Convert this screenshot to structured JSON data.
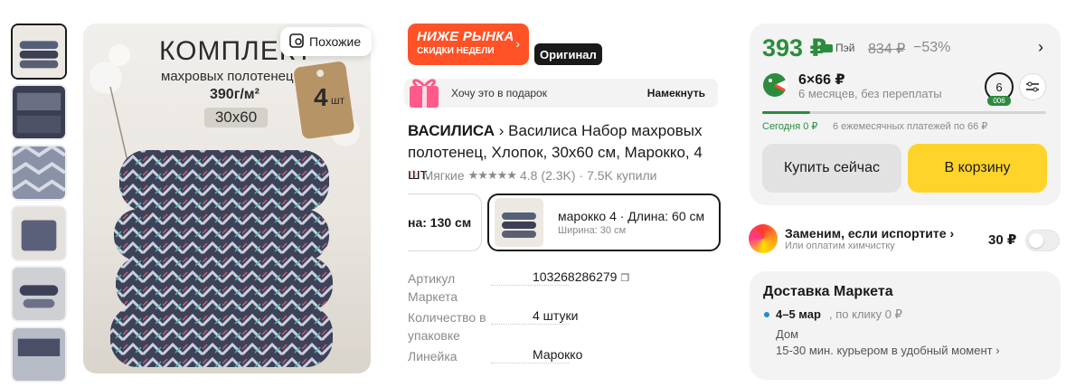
{
  "gallery": {
    "similar_label": "Похожие",
    "image_texts": {
      "headline": "КОМПЛЕКТ",
      "subline": "махровых полотенец",
      "density": "390г/м²",
      "size": "30х60",
      "tag_count": "4",
      "tag_unit": "шт"
    }
  },
  "promo": {
    "title": "НИЖЕ РЫНКА",
    "subtitle": "СКИДКИ НЕДЕЛИ"
  },
  "original_badge": "Оригинал",
  "gift": {
    "label": "Хочу это в подарок",
    "action": "Намекнуть"
  },
  "product": {
    "brand": "ВАСИЛИСА",
    "title": "Василиса Набор махровых полотенец, Хлопок, 30х60 см, Марокко, 4 шт.",
    "tag": "Мягкие",
    "stars": "★★★★★",
    "rating": "4.8",
    "reviews": "(2.3K)",
    "bought": "· 7.5K купили"
  },
  "variants": [
    {
      "label": "на: 130 см"
    },
    {
      "label": "марокко 4 · Длина: 60 см",
      "sub": "Ширина: 30 см"
    }
  ],
  "specs": [
    {
      "key": "Артикул Маркета",
      "value": "103268286279"
    },
    {
      "key": "Количество в упаковке",
      "value": "4 штуки"
    },
    {
      "key": "Линейка",
      "value": "Марокко"
    }
  ],
  "price": {
    "current": "393 ₽",
    "pay_label": "Пэй",
    "old": "834 ₽",
    "discount": "−53%",
    "installment": "6×66 ₽",
    "installment_note": "6 месяцев, без переплаты",
    "count": "6",
    "count_badge": "006",
    "today": "Сегодня 0 ₽",
    "months": "6 ежемесячных платежей по 66 ₽",
    "progress": 0.17,
    "buy_now": "Купить сейчас",
    "to_cart": "В корзину"
  },
  "replace": {
    "title": "Заменим, если испортите",
    "sub": "Или оплатим химчистку",
    "price": "30 ₽",
    "enabled": false
  },
  "delivery": {
    "title": "Доставка Маркета",
    "date": "4–5 мар",
    "click": ", по клику  0 ₽",
    "home": "Дом",
    "courier": "15-30 мин. курьером в удобный момент"
  },
  "colors": {
    "green": "#2c8c3e",
    "promo": "#ff5226",
    "cart": "#fed42b"
  }
}
